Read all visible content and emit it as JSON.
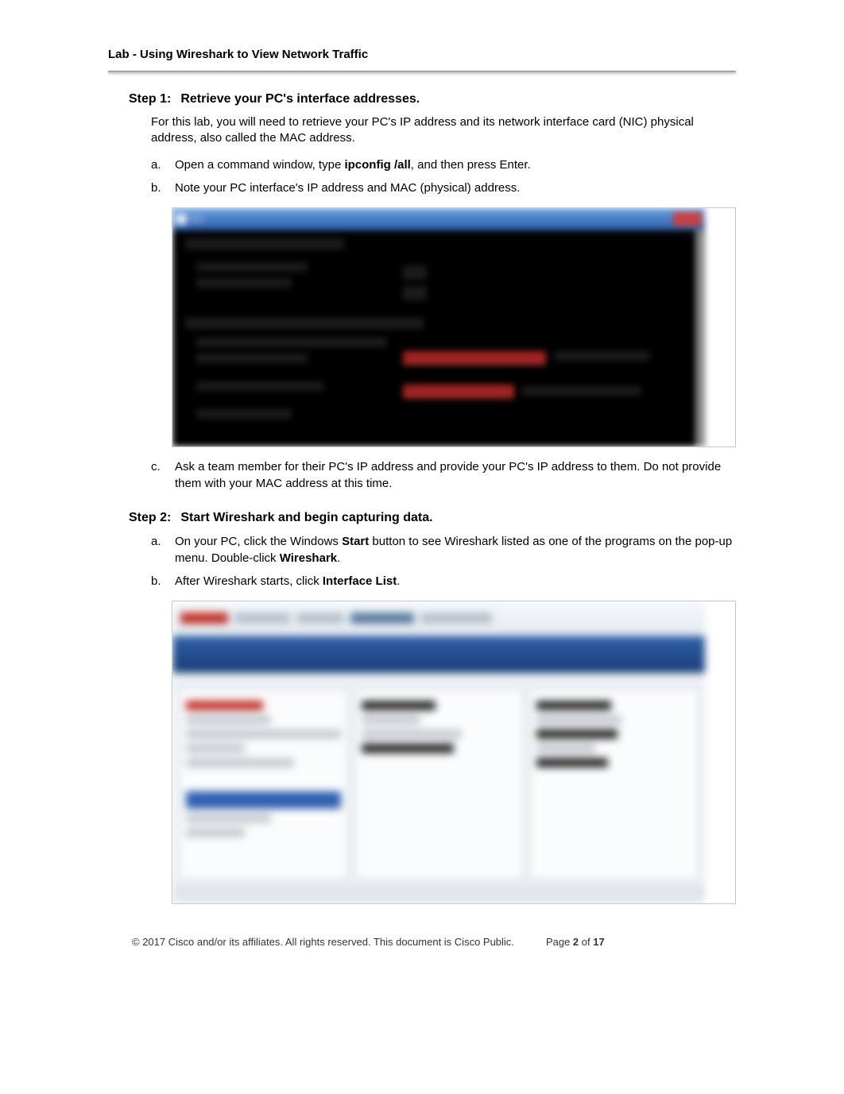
{
  "header": {
    "title": "Lab - Using Wireshark to View Network Traffic"
  },
  "step1": {
    "label": "Step 1:",
    "title": "Retrieve your PC's interface addresses.",
    "intro": "For this lab, you will need to retrieve your PC's IP address and its network interface card (NIC) physical address, also called the MAC address.",
    "item_a_pre": "Open a command window, type ",
    "item_a_cmd": "ipconfig /all",
    "item_a_post": ", and then press Enter.",
    "item_b": "Note your PC interface's IP address and MAC (physical) address.",
    "item_c": "Ask a team member for their PC's IP address and provide your PC's IP address to them. Do not provide them with your MAC address at this time."
  },
  "step2": {
    "label": "Step 2:",
    "title": "Start Wireshark and begin capturing data.",
    "item_a_pre": "On your PC, click the Windows ",
    "item_a_b1": "Start",
    "item_a_mid": " button to see Wireshark listed as one of the programs on the pop-up menu. Double-click ",
    "item_a_b2": "Wireshark",
    "item_a_post": ".",
    "item_b_pre": "After Wireshark starts, click ",
    "item_b_b1": "Interface List",
    "item_b_post": "."
  },
  "letters": {
    "a": "a.",
    "b": "b.",
    "c": "c."
  },
  "footer": {
    "copyright": "© 2017 Cisco and/or its affiliates. All rights reserved. This document is Cisco Public.",
    "page_pre": "Page ",
    "page_cur": "2",
    "page_mid": " of ",
    "page_total": "17"
  }
}
